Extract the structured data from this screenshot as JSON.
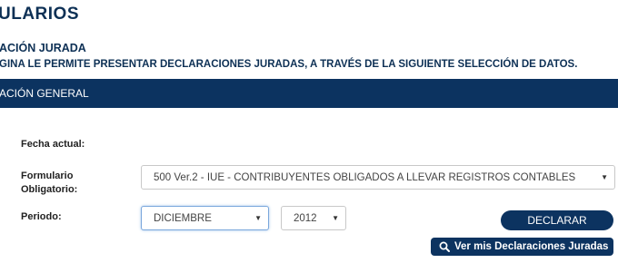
{
  "header": {
    "title": "ULARIOS"
  },
  "section": {
    "title": "ACIÓN JURADA",
    "description": "GINA LE PERMITE PRESENTAR DECLARACIONES JURADAS, A TRAVÉS DE LA SIGUIENTE SELECCIÓN DE DATOS."
  },
  "bar": {
    "title": "ACIÓN GENERAL"
  },
  "form": {
    "fecha_label": "Fecha actual:",
    "formulario_label_line1": "Formulario",
    "formulario_label_line2": "Obligatorio:",
    "formulario_value": "500 Ver.2 - IUE - CONTRIBUYENTES OBLIGADOS A LLEVAR REGISTROS CONTABLES",
    "periodo_label": "Periodo:",
    "mes_value": "DICIEMBRE",
    "anio_value": "2012"
  },
  "buttons": {
    "declarar": "DECLARAR",
    "ver_declaraciones": "Ver mis Declaraciones Juradas"
  },
  "colors": {
    "primary": "#0c3360",
    "heading": "#0d3055"
  },
  "icons": {
    "dropdown": "chevron-down-icon",
    "search": "search-icon"
  }
}
